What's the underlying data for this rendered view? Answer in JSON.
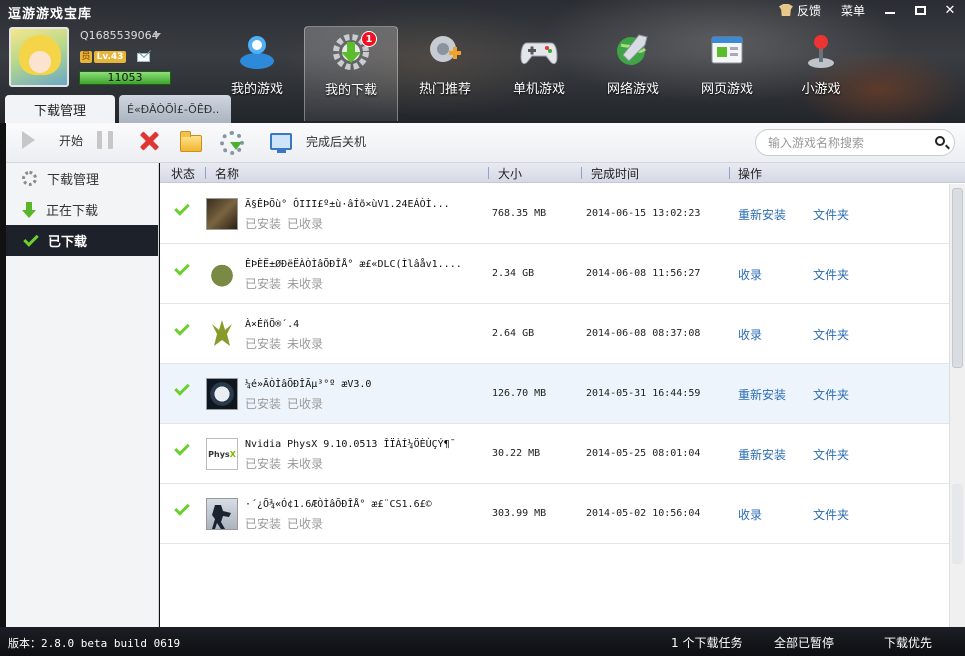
{
  "app": {
    "title": "逗游游戏宝库"
  },
  "window_links": {
    "feedback": "反馈",
    "menu": "菜单",
    "minimize": "—",
    "maximize": "□",
    "close": "✕"
  },
  "user": {
    "id": "Q1685539064",
    "vip": "员",
    "level": "Lv.43",
    "points": "11053"
  },
  "nav": {
    "items": [
      {
        "label": "我的游戏",
        "icon": "my-games-icon"
      },
      {
        "label": "我的下载",
        "icon": "download-gear-icon",
        "badge": "1"
      },
      {
        "label": "热门推荐",
        "icon": "hot-recommend-icon"
      },
      {
        "label": "单机游戏",
        "icon": "gamepad-icon"
      },
      {
        "label": "网络游戏",
        "icon": "globe-sword-icon"
      },
      {
        "label": "网页游戏",
        "icon": "web-browser-icon"
      },
      {
        "label": "小游戏",
        "icon": "joystick-icon"
      }
    ]
  },
  "tabs": [
    {
      "label": "下载管理"
    },
    {
      "label": "É«ÐÂÒÕÌ£-ÕÊÐ.."
    }
  ],
  "toolbar": {
    "start": "开始",
    "shutdown": "完成后关机",
    "search_placeholder": "输入游戏名称搜索"
  },
  "sidebar": {
    "items": [
      {
        "label": "下载管理",
        "icon": "gear-icon"
      },
      {
        "label": "正在下载",
        "icon": "download-arrow-icon"
      },
      {
        "label": "已下载",
        "icon": "check-icon"
      }
    ]
  },
  "table": {
    "columns": {
      "status": "状态",
      "name": "名称",
      "size": "大小",
      "time": "完成时间",
      "action": "操作"
    },
    "rows": [
      {
        "name": "Ä§ÊÞÕù° ÔIII£º±ù·âÍõ×ùV1.24EÁÒÌ...",
        "installed": "已安装",
        "collected": "已收录",
        "size": "768.35 MB",
        "time": "2014-06-15 13:02:23",
        "action": "重新安装",
        "folder": "文件夹"
      },
      {
        "name": "ÊÞÈË±ØÐëËÀÒÌâÕÐÎÅ° æ£«DLC(Ìlâåv1....",
        "installed": "已安装",
        "collected": "未收录",
        "size": "2.34 GB",
        "time": "2014-06-08 11:56:27",
        "action": "收录",
        "folder": "文件夹"
      },
      {
        "name": "À×ÉñÕ®´.4",
        "installed": "已安装",
        "collected": "未收录",
        "size": "2.64 GB",
        "time": "2014-06-08 08:37:08",
        "action": "收录",
        "folder": "文件夹"
      },
      {
        "name": "¼é»ÃÒÌâÕÐÎÃµ³°º æV3.0",
        "installed": "已安装",
        "collected": "已收录",
        "size": "126.70 MB",
        "time": "2014-05-31 16:44:59",
        "action": "重新安装",
        "folder": "文件夹"
      },
      {
        "name": "Nvidia PhysX 9.10.0513 ÎÏÀÍ¼ÖÈÙÇÝ¶¯",
        "installed": "已安装",
        "collected": "未收录",
        "size": "30.22 MB",
        "time": "2014-05-25 08:01:04",
        "action": "重新安装",
        "folder": "文件夹"
      },
      {
        "name": "·´¿Õ¾«Ó¢1.6ÆÒÌâÕÐÎÅ° æ£¨CS1.6£©",
        "installed": "已安装",
        "collected": "已收录",
        "size": "303.99 MB",
        "time": "2014-05-02 10:56:04",
        "action": "收录",
        "folder": "文件夹"
      }
    ]
  },
  "status_bar": {
    "version": "版本：2.8.0 beta build 0619",
    "tasks": "1 个下载任务",
    "pause_all": "全部已暂停",
    "priority": "下载优先"
  },
  "colors": {
    "accent_green": "#6ccf2f",
    "link_blue": "#2b6cb4",
    "badge_red": "#e11122",
    "sidebar_active": "#1d2129"
  }
}
